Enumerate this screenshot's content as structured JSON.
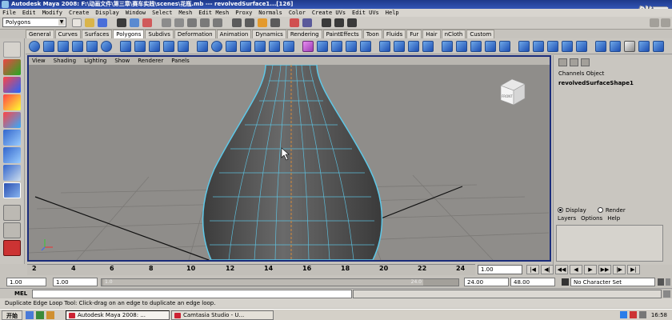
{
  "title_bar": {
    "title": "Autodesk Maya 2008: F:\\动画文件\\第三章\\赛车实践\\scenes\\花瓶.mb  ---  revolvedSurface1...[126]",
    "watermark": "俏西"
  },
  "menubar": [
    "File",
    "Edit",
    "Modify",
    "Create",
    "Display",
    "Window",
    "Select",
    "Mesh",
    "Edit Mesh",
    "Proxy",
    "Normals",
    "Color",
    "Create UVs",
    "Edit UVs",
    "Help"
  ],
  "status_line": {
    "mode": "Polygons"
  },
  "shelf_tabs": [
    "General",
    "Curves",
    "Surfaces",
    "Polygons",
    "Subdivs",
    "Deformation",
    "Animation",
    "Dynamics",
    "Rendering",
    "PaintEffects",
    "Toon",
    "Fluids",
    "Fur",
    "Hair",
    "nCloth",
    "Custom"
  ],
  "active_shelf_tab": "Polygons",
  "panel_menu": [
    "View",
    "Shading",
    "Lighting",
    "Show",
    "Renderer",
    "Panels"
  ],
  "view_cube_label": "FRONT",
  "channel_box": {
    "tabs": "Channels  Object",
    "object_name": "revolvedSurfaceShape1"
  },
  "layer_editor": {
    "display_label": "Display",
    "render_label": "Render",
    "menu": [
      "Layers",
      "Options",
      "Help"
    ]
  },
  "time_slider": {
    "ticks": [
      "2",
      "4",
      "6",
      "8",
      "10",
      "12",
      "14",
      "16",
      "18",
      "20",
      "22",
      "24"
    ],
    "current_frame": "1.00"
  },
  "range_slider": {
    "start": "1.00",
    "start_inner": "1.00",
    "bar_left": "1.0",
    "bar_right": "24.0",
    "end_inner": "24.00",
    "end": "48.00",
    "character_set": "No Character Set"
  },
  "command_line": {
    "label": "MEL"
  },
  "help_line": "Duplicate Edge Loop Tool: Click-drag on an edge to duplicate an edge loop.",
  "taskbar": {
    "start": "开始",
    "tasks": [
      "Autodesk Maya 2008: ...",
      "Camtasia Studio - U..."
    ],
    "clock": "16:58"
  }
}
